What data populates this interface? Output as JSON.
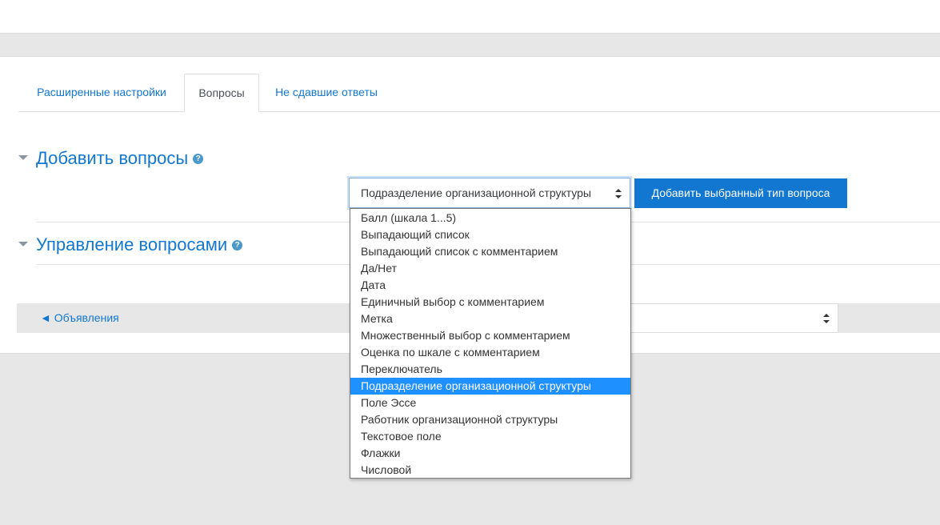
{
  "tabs": [
    {
      "label": "Расширенные настройки",
      "active": false
    },
    {
      "label": "Вопросы",
      "active": true
    },
    {
      "label": "Не сдавшие ответы",
      "active": false
    }
  ],
  "add_section": {
    "title": "Добавить вопросы",
    "help_icon": "?"
  },
  "manage_section": {
    "title": "Управление вопросами",
    "help_icon": "?"
  },
  "question_type_select": {
    "value": "Подразделение организационной структуры",
    "options": [
      "Балл (шкала 1...5)",
      "Выпадающий список",
      "Выпадающий список с комментарием",
      "Да/Нет",
      "Дата",
      "Единичный выбор с комментарием",
      "Метка",
      "Множественный выбор с комментарием",
      "Оценка по шкале с комментарием",
      "Переключатель",
      "Подразделение организационной структуры",
      "Поле Эссе",
      "Работник организационной структуры",
      "Текстовое поле",
      "Флажки",
      "Числовой"
    ],
    "selected_index": 10
  },
  "add_button": {
    "label": "Добавить выбранный тип вопроса"
  },
  "navigation": {
    "prev_link": "◄ Объявления"
  },
  "colors": {
    "accent": "#1177d1",
    "selected_option": "#1e90ff",
    "page_bg": "#e7e7e7"
  }
}
